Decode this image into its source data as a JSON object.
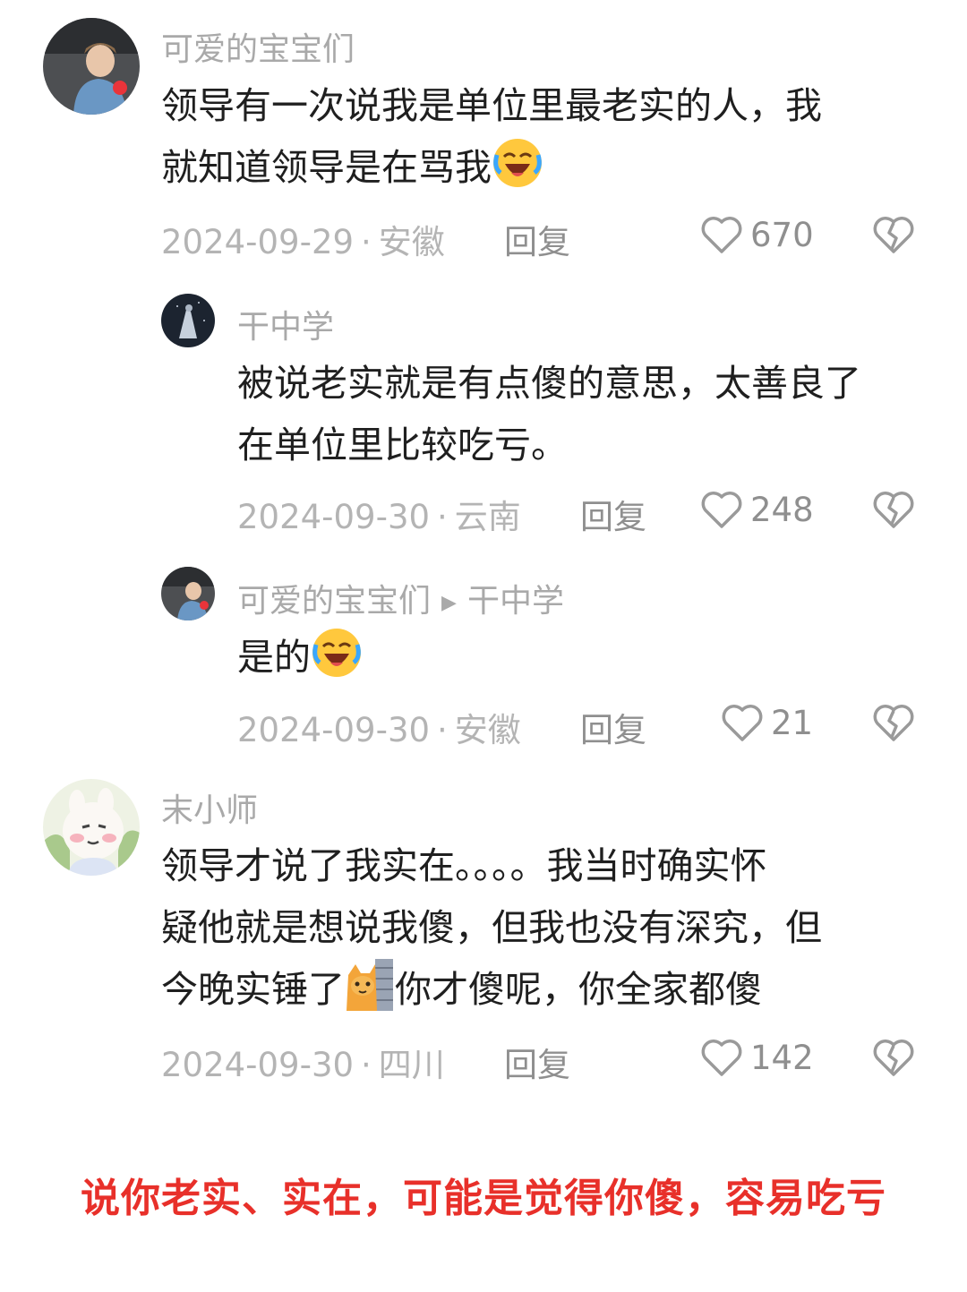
{
  "comments": [
    {
      "author": "可爱的宝宝们",
      "lines": [
        "领导有一次说我是单位里最老实的人，我",
        "就知道领导是在骂我"
      ],
      "date": "2024-09-29",
      "location": "安徽",
      "reply_label": "回复",
      "likes": "670"
    },
    {
      "author": "干中学",
      "lines": [
        "被说老实就是有点傻的意思，太善良了",
        "在单位里比较吃亏。"
      ],
      "date": "2024-09-30",
      "location": "云南",
      "reply_label": "回复",
      "likes": "248"
    },
    {
      "author": "可爱的宝宝们",
      "reply_to": "干中学",
      "lines": [
        "是的"
      ],
      "date": "2024-09-30",
      "location": "安徽",
      "reply_label": "回复",
      "likes": "21"
    },
    {
      "author": "末小师",
      "lines": [
        "领导才说了我实在。。。。我当时确实怀",
        "疑他就是想说我傻，但我也没有深究，但",
        "今晚实锤了",
        "你才傻呢，你全家都傻"
      ],
      "date": "2024-09-30",
      "location": "四川",
      "reply_label": "回复",
      "likes": "142"
    }
  ],
  "caption": "说你老实、实在，可能是觉得你傻，容易吃亏",
  "icons": {
    "like": "heart-outline-icon",
    "dislike": "broken-heart-icon",
    "laugh_emoji": "laughing-crying-emoji",
    "cat_emoji": "peeking-cat-emoji"
  },
  "colors": {
    "caption": "#e8302a",
    "muted": "#a9a9a9"
  }
}
